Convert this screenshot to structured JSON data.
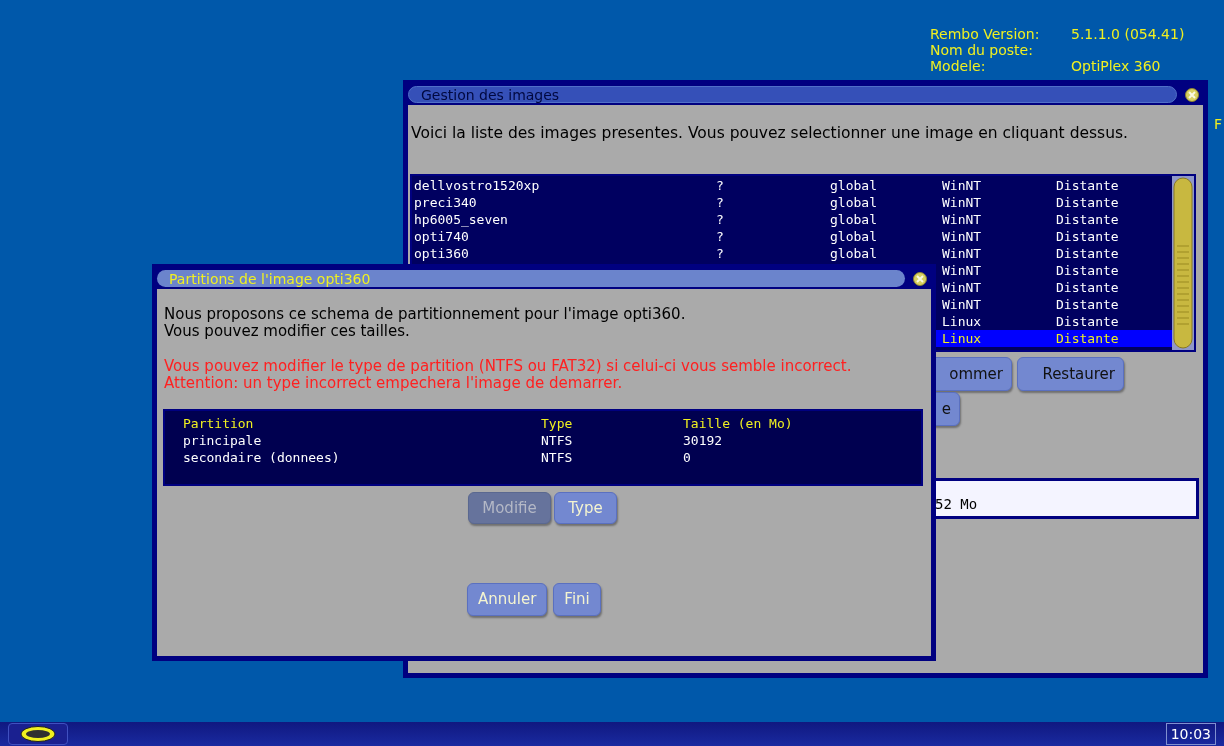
{
  "info": [
    {
      "label": "Rembo Version:",
      "value": "5.1.1.0 (054.41)"
    },
    {
      "label": "Nom du poste:"
    },
    {
      "label": "Modele:",
      "value": "OptiPlex 360"
    }
  ],
  "edge_text": "F",
  "images_window": {
    "title": "Gestion des images",
    "intro": "Voici la liste des images presentes. Vous pouvez selectionner une image en cliquant dessus.",
    "rows": [
      {
        "name": "dellvostro1520xp",
        "col_2": "?",
        "col_3": "global",
        "os": "WinNT",
        "location": "Distante",
        "selected": false
      },
      {
        "name": "preci340",
        "col_2": "?",
        "col_3": "global",
        "os": "WinNT",
        "location": "Distante",
        "selected": false
      },
      {
        "name": "hp6005_seven",
        "col_2": "?",
        "col_3": "global",
        "os": "WinNT",
        "location": "Distante",
        "selected": false
      },
      {
        "name": "opti740",
        "col_2": "?",
        "col_3": "global",
        "os": "WinNT",
        "location": "Distante",
        "selected": false
      },
      {
        "name": "opti360",
        "col_2": "?",
        "col_3": "global",
        "os": "WinNT",
        "location": "Distante",
        "selected": false
      },
      {
        "os": "WinNT",
        "location": "Distante",
        "selected": false
      },
      {
        "os": "WinNT",
        "location": "Distante",
        "selected": false
      },
      {
        "os": "WinNT",
        "location": "Distante",
        "selected": false
      },
      {
        "os": "Linux",
        "location": "Distante",
        "selected": false
      },
      {
        "os": "Linux",
        "location": "Distante",
        "selected": true
      }
    ],
    "buttons": [
      {
        "label": "ommer"
      },
      {
        "label": "Restaurer"
      }
    ],
    "buttons_row_2": [
      {
        "label": "e"
      }
    ],
    "info_field": {
      "value": "52 Mo"
    }
  },
  "partitions_dialog": {
    "title": "Partitions de l'image opti360",
    "message": [
      "Nous proposons ce schema de partitionnement pour l'image opti360.",
      "Vous pouvez modifier ces tailles."
    ],
    "warning": [
      "Vous pouvez modifier le type de partition (NTFS ou FAT32) si celui-ci vous semble incorrect.",
      "Attention: un type incorrect empechera l'image de demarrer."
    ],
    "columns": [
      "Partition",
      "Type",
      "Taille (en Mo)"
    ],
    "rows": [
      [
        "principale",
        "NTFS",
        "30192"
      ],
      [
        "secondaire (donnees)",
        "NTFS",
        "0"
      ]
    ],
    "buttons": [
      {
        "label": "Modifie",
        "disabled": true
      },
      {
        "label": "Type",
        "disabled": false
      }
    ],
    "footer_buttons": [
      {
        "label": "Annuler"
      },
      {
        "label": "Fini"
      }
    ]
  },
  "taskbar": {
    "clock": "10:03"
  }
}
